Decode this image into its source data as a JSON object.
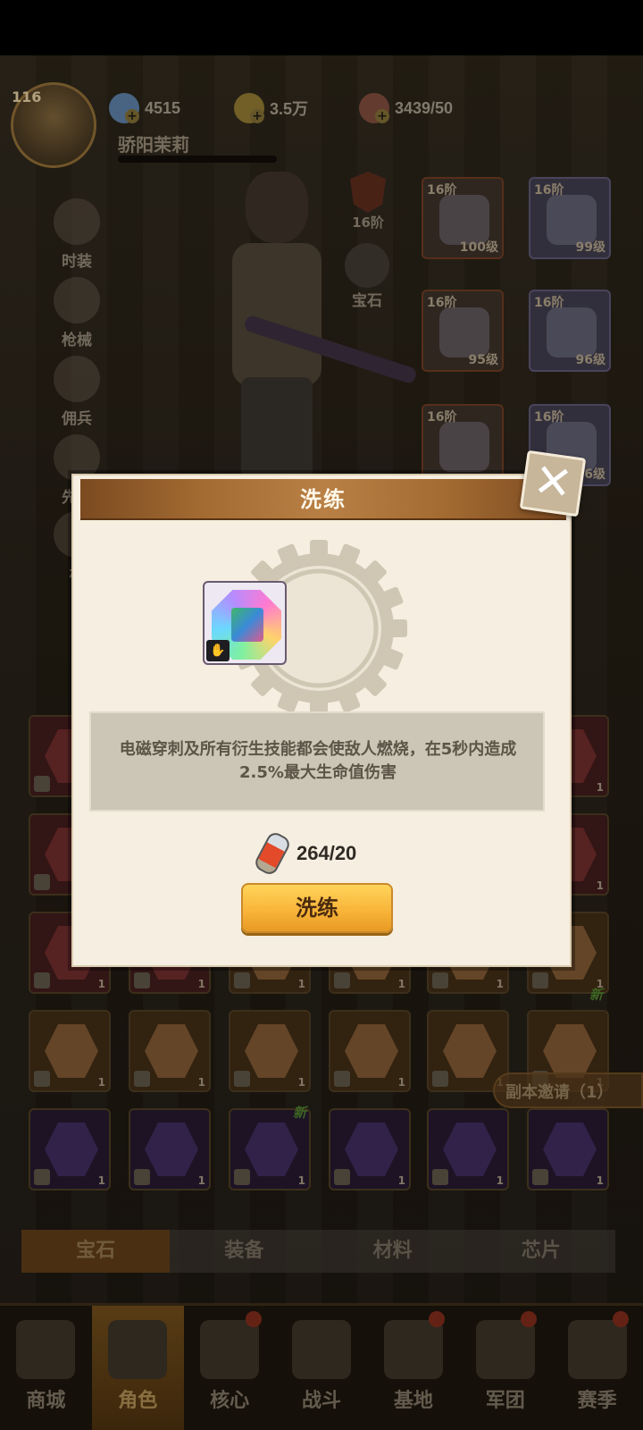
{
  "player": {
    "level": "116",
    "name": "骄阳茉莉"
  },
  "resources": {
    "gems": "4515",
    "gold": "3.5万",
    "stamina": "3439/50"
  },
  "side_menu": [
    "时装",
    "枪械",
    "佣兵",
    "先锋",
    "机"
  ],
  "hero_panel": {
    "grade_label": "16阶",
    "gem_button_label": "宝石",
    "equipment": [
      {
        "tier": "16阶",
        "level": "100级"
      },
      {
        "tier": "16阶",
        "level": "99级"
      },
      {
        "tier": "16阶",
        "level": "95级"
      },
      {
        "tier": "16阶",
        "level": "96级"
      },
      {
        "tier": "16阶",
        "level": ""
      },
      {
        "tier": "16阶",
        "level": "96级"
      }
    ]
  },
  "inventory": {
    "count_label": "1",
    "new_tag": "新"
  },
  "invite_label": "副本邀请（1）",
  "tabs": [
    "宝石",
    "装备",
    "材料",
    "芯片"
  ],
  "bottom_nav": [
    "商城",
    "角色",
    "核心",
    "战斗",
    "基地",
    "军团",
    "赛季"
  ],
  "dialog": {
    "title": "洗练",
    "description": "电磁穿刺及所有衍生技能都会使敌人燃烧，在5秒内造成2.5%最大生命值伤害",
    "cost": "264/20",
    "button_label": "洗练",
    "close_icon": "close-icon"
  },
  "colors": {
    "dialog_bg": "#f6eee0",
    "header": "#a36b32",
    "button": "#f8b53a"
  }
}
